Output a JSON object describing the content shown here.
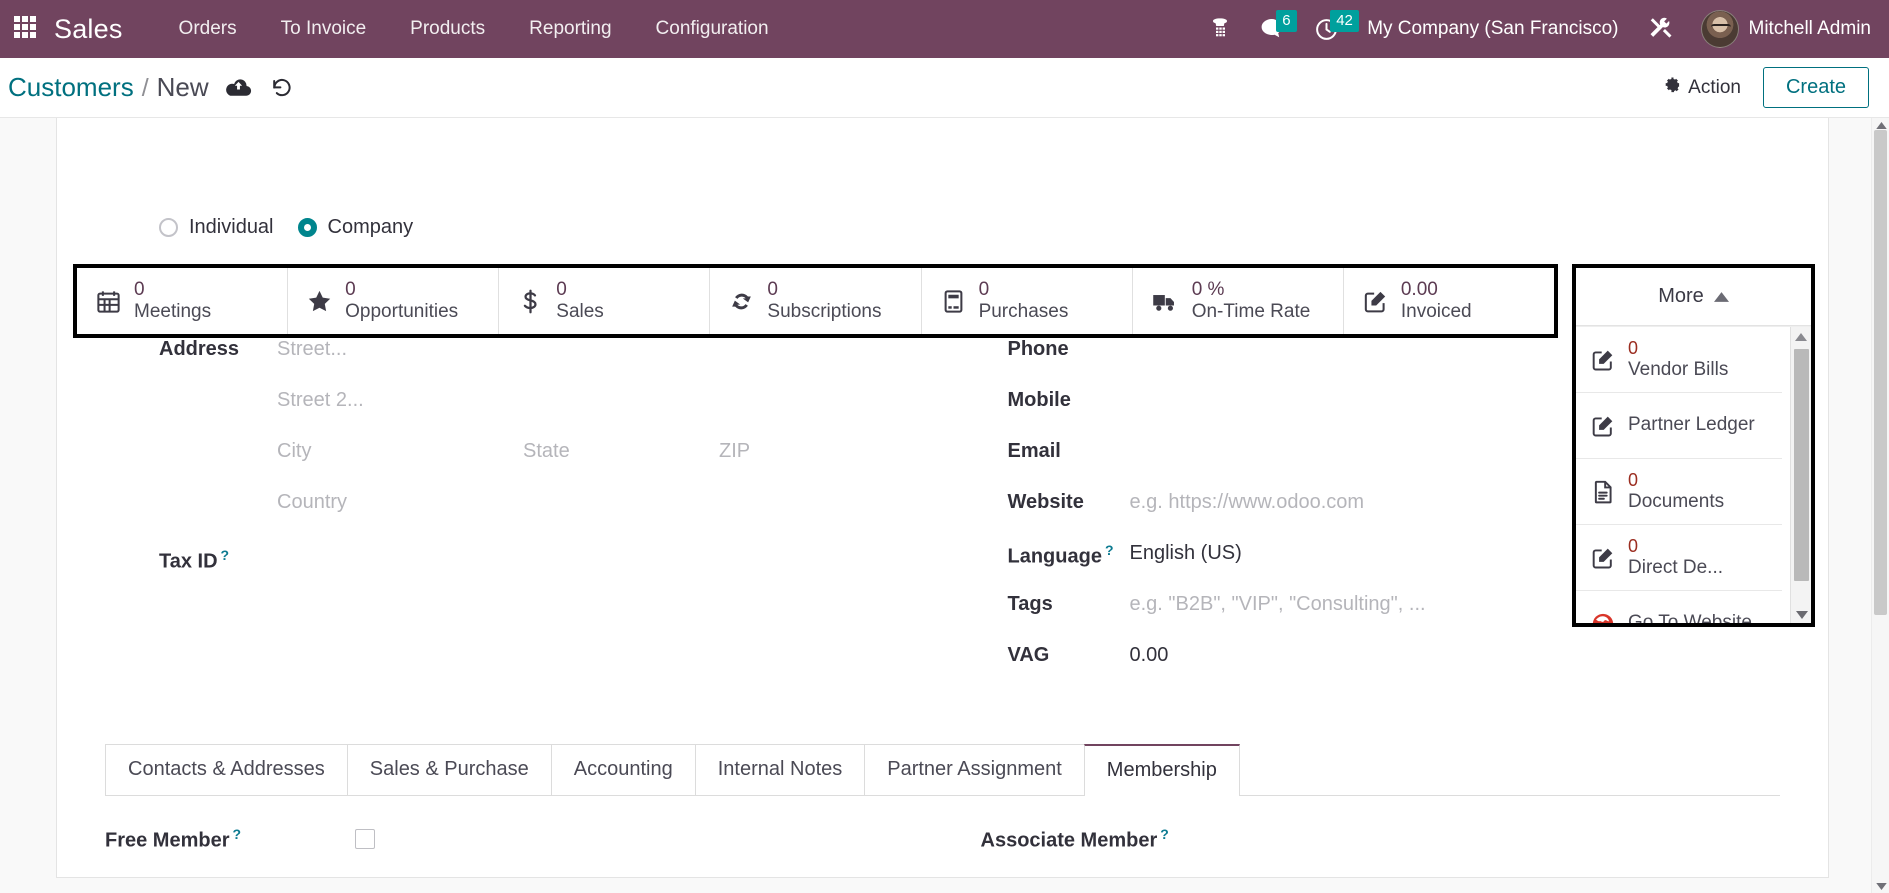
{
  "navbar": {
    "apps_icon": "apps-grid-icon",
    "brand": "Sales",
    "menu": [
      {
        "label": "Orders"
      },
      {
        "label": "To Invoice"
      },
      {
        "label": "Products"
      },
      {
        "label": "Reporting"
      },
      {
        "label": "Configuration"
      }
    ],
    "icons": [
      {
        "name": "voip-phone-icon",
        "badge": ""
      },
      {
        "name": "messages-icon",
        "badge": "6"
      },
      {
        "name": "activities-clock-icon",
        "badge": "42"
      }
    ],
    "company": "My Company (San Francisco)",
    "debug_icon": "tools-wrench-icon",
    "user": "Mitchell Admin",
    "accent_purple": "#71445f",
    "badge_color": "#00a09d"
  },
  "control_panel": {
    "breadcrumb_root": "Customers",
    "breadcrumb_sep": "/",
    "breadcrumb_current": "New",
    "save_icon": "cloud-upload-save-icon",
    "discard_icon": "undo-discard-icon",
    "action_label": "Action",
    "action_icon": "gear-icon",
    "create_label": "Create",
    "create_color": "#00707f"
  },
  "stat_buttons": [
    {
      "value": "0",
      "label": "Meetings",
      "icon": "calendar-icon"
    },
    {
      "value": "0",
      "label": "Opportunities",
      "icon": "star-icon"
    },
    {
      "value": "0",
      "label": "Sales",
      "icon": "dollar-icon"
    },
    {
      "value": "0",
      "label": "Subscriptions",
      "icon": "refresh-icon"
    },
    {
      "value": "0",
      "label": "Purchases",
      "icon": "credit-card-icon"
    },
    {
      "value": "0 %",
      "label": "On-Time Rate",
      "icon": "truck-icon"
    },
    {
      "value": "0.00",
      "label": "Invoiced",
      "icon": "pencil-square-icon"
    }
  ],
  "more_dropdown": {
    "label": "More",
    "chevron_icon": "chevron-up-icon",
    "items": [
      {
        "value": "0",
        "label": "Vendor Bills",
        "icon": "pencil-square-icon"
      },
      {
        "value": "",
        "label": "Partner Ledger",
        "icon": "pencil-square-icon"
      },
      {
        "value": "0",
        "label": "Documents",
        "icon": "document-icon"
      },
      {
        "value": "0",
        "label": "Direct De...",
        "icon": "pencil-square-icon"
      },
      {
        "value": "",
        "label": "Go To Website",
        "icon": "globe-icon"
      }
    ],
    "scrollbar": {
      "up_icon": "scroll-up-arrow-icon",
      "down_icon": "scroll-down-arrow-icon"
    }
  },
  "form": {
    "type_radio": {
      "individual": "Individual",
      "company": "Company",
      "selected": "Company"
    },
    "left": {
      "address_label": "Address",
      "street_ph": "Street...",
      "street2_ph": "Street 2...",
      "city_ph": "City",
      "state_ph": "State",
      "zip_ph": "ZIP",
      "country_ph": "Country",
      "tax_id_label": "Tax ID",
      "tax_id_value": ""
    },
    "right": [
      {
        "label": "Phone",
        "value": "",
        "placeholder": "",
        "tooltip": false
      },
      {
        "label": "Mobile",
        "value": "",
        "placeholder": "",
        "tooltip": false
      },
      {
        "label": "Email",
        "value": "",
        "placeholder": "",
        "tooltip": false
      },
      {
        "label": "Website",
        "value": "",
        "placeholder": "e.g. https://www.odoo.com",
        "tooltip": false
      },
      {
        "label": "Language",
        "value": "English (US)",
        "placeholder": "",
        "tooltip": true
      },
      {
        "label": "Tags",
        "value": "",
        "placeholder": "e.g. \"B2B\", \"VIP\", \"Consulting\", ...",
        "tooltip": false
      },
      {
        "label": "VAG",
        "value": "0.00",
        "placeholder": "",
        "tooltip": false
      }
    ]
  },
  "notebook": {
    "tabs": [
      {
        "label": "Contacts & Addresses",
        "active": false
      },
      {
        "label": "Sales & Purchase",
        "active": false
      },
      {
        "label": "Accounting",
        "active": false
      },
      {
        "label": "Internal Notes",
        "active": false
      },
      {
        "label": "Partner Assignment",
        "active": false
      },
      {
        "label": "Membership",
        "active": true
      }
    ],
    "membership": {
      "free_member_label": "Free Member",
      "free_member_checked": false,
      "associate_member_label": "Associate Member"
    }
  }
}
